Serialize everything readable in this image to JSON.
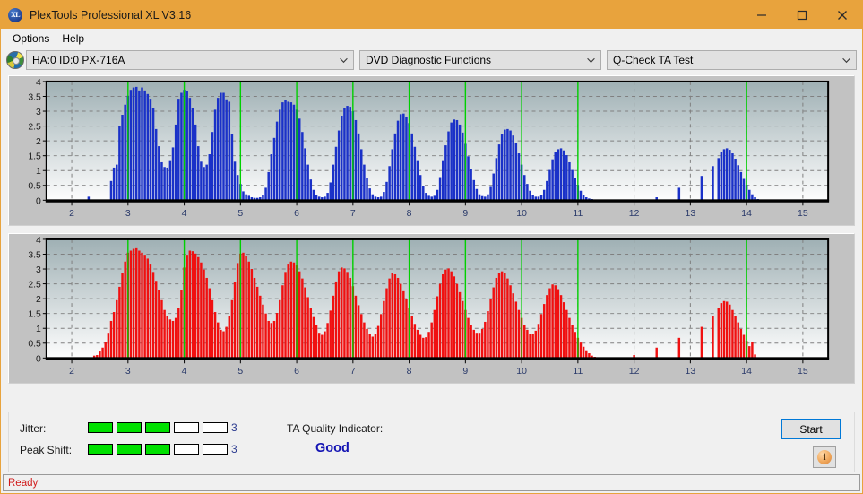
{
  "window": {
    "title": "PlexTools Professional XL V3.16",
    "app_icon": "xl-logo-icon",
    "titlebar_color": "#e8a33d",
    "minimize_label": "Minimize",
    "maximize_label": "Maximize",
    "close_label": "Close"
  },
  "menu": {
    "items": [
      {
        "label": "Options"
      },
      {
        "label": "Help"
      }
    ]
  },
  "selectors": {
    "drive": {
      "icon": "disc-icon",
      "value": "HA:0 ID:0  PX-716A"
    },
    "function": {
      "value": "DVD Diagnostic Functions"
    },
    "test": {
      "value": "Q-Check TA Test"
    }
  },
  "results": {
    "jitter_label": "Jitter:",
    "jitter_value": "3",
    "jitter_segments_total": 5,
    "jitter_segments_on": 3,
    "peak_shift_label": "Peak Shift:",
    "peak_shift_value": "3",
    "peak_segments_total": 5,
    "peak_segments_on": 3,
    "meter_on_color": "#00e000",
    "ta_quality_label": "TA Quality Indicator:",
    "ta_quality_value": "Good",
    "ta_quality_color": "#1414b4",
    "start_label": "Start",
    "info_label": "i"
  },
  "statusbar": {
    "text": "Ready",
    "color": "#d11a1a"
  },
  "chart_data": [
    {
      "id": "jitter-chart",
      "type": "bar",
      "title": "",
      "xlabel": "",
      "ylabel": "",
      "bar_color": "#1a31c8",
      "plot_bg_top": "#9fb0b4",
      "plot_bg_bottom": "#fdfdfd",
      "grid": true,
      "gridline_color": "#808080",
      "marker_color": "#00d000",
      "marker_positions": [
        3,
        4,
        5,
        6,
        7,
        8,
        9,
        10,
        11,
        14
      ],
      "xlim": [
        1.55,
        15.45
      ],
      "ylim": [
        0,
        4
      ],
      "yticks": [
        0,
        0.5,
        1,
        1.5,
        2,
        2.5,
        3,
        3.5,
        4
      ],
      "ytick_labels": [
        "0",
        "0.5",
        "1",
        "1.5",
        "2",
        "2.5",
        "3",
        "3.5",
        "4"
      ],
      "xticks": [
        2,
        3,
        4,
        5,
        6,
        7,
        8,
        9,
        10,
        11,
        12,
        13,
        14,
        15
      ],
      "xtick_labels": [
        "2",
        "3",
        "4",
        "5",
        "6",
        "7",
        "8",
        "9",
        "10",
        "11",
        "12",
        "13",
        "14",
        "15"
      ],
      "x": [
        1.6,
        1.7,
        1.8,
        1.9,
        2.0,
        2.1,
        2.2,
        2.3,
        2.4,
        2.5,
        2.6,
        2.7,
        2.75,
        2.8,
        2.85,
        2.9,
        2.95,
        3.0,
        3.05,
        3.1,
        3.15,
        3.2,
        3.25,
        3.3,
        3.35,
        3.4,
        3.45,
        3.5,
        3.55,
        3.6,
        3.65,
        3.7,
        3.75,
        3.8,
        3.85,
        3.9,
        3.95,
        4.0,
        4.05,
        4.1,
        4.15,
        4.2,
        4.25,
        4.3,
        4.35,
        4.4,
        4.45,
        4.5,
        4.55,
        4.6,
        4.65,
        4.7,
        4.75,
        4.8,
        4.85,
        4.9,
        4.95,
        5.0,
        5.05,
        5.1,
        5.15,
        5.2,
        5.25,
        5.3,
        5.35,
        5.4,
        5.45,
        5.5,
        5.55,
        5.6,
        5.65,
        5.7,
        5.75,
        5.8,
        5.85,
        5.9,
        5.95,
        6.0,
        6.05,
        6.1,
        6.15,
        6.2,
        6.25,
        6.3,
        6.35,
        6.4,
        6.45,
        6.5,
        6.55,
        6.6,
        6.65,
        6.7,
        6.75,
        6.8,
        6.85,
        6.9,
        6.95,
        7.0,
        7.05,
        7.1,
        7.15,
        7.2,
        7.25,
        7.3,
        7.35,
        7.4,
        7.45,
        7.5,
        7.55,
        7.6,
        7.65,
        7.7,
        7.75,
        7.8,
        7.85,
        7.9,
        7.95,
        8.0,
        8.05,
        8.1,
        8.15,
        8.2,
        8.25,
        8.3,
        8.35,
        8.4,
        8.45,
        8.5,
        8.55,
        8.6,
        8.65,
        8.7,
        8.75,
        8.8,
        8.85,
        8.9,
        8.95,
        9.0,
        9.05,
        9.1,
        9.15,
        9.2,
        9.25,
        9.3,
        9.35,
        9.4,
        9.45,
        9.5,
        9.55,
        9.6,
        9.65,
        9.7,
        9.75,
        9.8,
        9.85,
        9.9,
        9.95,
        10.0,
        10.05,
        10.1,
        10.15,
        10.2,
        10.25,
        10.3,
        10.35,
        10.4,
        10.45,
        10.5,
        10.55,
        10.6,
        10.65,
        10.7,
        10.75,
        10.8,
        10.85,
        10.9,
        10.95,
        11.0,
        11.05,
        11.1,
        11.15,
        11.2,
        11.25,
        11.3,
        11.4,
        11.5,
        11.6,
        11.8,
        12.0,
        12.4,
        12.8,
        13.2,
        13.4,
        13.5,
        13.55,
        13.6,
        13.65,
        13.7,
        13.75,
        13.8,
        13.85,
        13.9,
        13.95,
        14.0,
        14.05,
        14.1,
        14.15,
        14.2,
        14.25,
        14.3,
        14.4,
        14.6,
        14.8,
        15.0,
        15.2,
        15.4
      ],
      "values": [
        0,
        0,
        0,
        0,
        0,
        0,
        0,
        0.12,
        0,
        0,
        0,
        0.65,
        1.1,
        1.2,
        2.5,
        2.88,
        3.22,
        3.52,
        3.72,
        3.8,
        3.82,
        3.7,
        3.8,
        3.7,
        3.58,
        3.42,
        3.1,
        2.4,
        1.82,
        1.28,
        1.12,
        1.1,
        1.32,
        1.78,
        2.55,
        3.42,
        3.62,
        3.72,
        3.68,
        3.45,
        3.1,
        2.55,
        1.82,
        1.3,
        1.12,
        1.2,
        1.55,
        2.3,
        3.05,
        3.45,
        3.62,
        3.62,
        3.4,
        3.32,
        2.22,
        1.3,
        0.85,
        0.55,
        0.3,
        0.2,
        0.15,
        0.1,
        0.08,
        0.08,
        0.1,
        0.18,
        0.42,
        0.95,
        1.55,
        2.1,
        2.65,
        3.05,
        3.3,
        3.38,
        3.32,
        3.3,
        3.22,
        3.05,
        2.75,
        2.3,
        1.75,
        1.2,
        0.7,
        0.35,
        0.18,
        0.12,
        0.1,
        0.12,
        0.25,
        0.6,
        1.2,
        1.8,
        2.35,
        2.85,
        3.12,
        3.18,
        3.15,
        3.0,
        2.7,
        2.25,
        1.72,
        1.2,
        0.75,
        0.4,
        0.2,
        0.12,
        0.1,
        0.12,
        0.28,
        0.62,
        1.15,
        1.72,
        2.25,
        2.68,
        2.9,
        2.92,
        2.82,
        2.6,
        2.25,
        1.8,
        1.32,
        0.85,
        0.48,
        0.25,
        0.15,
        0.12,
        0.15,
        0.35,
        0.78,
        1.32,
        1.85,
        2.32,
        2.62,
        2.72,
        2.7,
        2.55,
        2.28,
        1.9,
        1.48,
        1.05,
        0.68,
        0.38,
        0.2,
        0.14,
        0.12,
        0.2,
        0.45,
        0.9,
        1.42,
        1.88,
        2.22,
        2.38,
        2.4,
        2.35,
        2.18,
        1.92,
        1.58,
        1.2,
        0.85,
        0.55,
        0.32,
        0.18,
        0.12,
        0.12,
        0.18,
        0.35,
        0.65,
        1.02,
        1.38,
        1.62,
        1.72,
        1.75,
        1.68,
        1.52,
        1.28,
        1.02,
        0.75,
        0.52,
        0.32,
        0.18,
        0.1,
        0.06,
        0.04,
        0.02,
        0,
        0,
        0,
        0,
        0,
        0.1,
        0.42,
        0.82,
        1.15,
        1.42,
        1.62,
        1.72,
        1.75,
        1.7,
        1.58,
        1.4,
        1.18,
        0.95,
        0.72,
        0.52,
        0.35,
        0.2,
        0.1,
        0.04,
        0,
        0,
        0,
        0,
        0
      ]
    },
    {
      "id": "peak-shift-chart",
      "type": "bar",
      "title": "",
      "xlabel": "",
      "ylabel": "",
      "bar_color": "#f01010",
      "plot_bg_top": "#9fb0b4",
      "plot_bg_bottom": "#fdfdfd",
      "grid": true,
      "gridline_color": "#808080",
      "marker_color": "#00d000",
      "marker_positions": [
        3,
        4,
        5,
        6,
        7,
        8,
        9,
        10,
        11,
        14
      ],
      "xlim": [
        1.55,
        15.45
      ],
      "ylim": [
        0,
        4
      ],
      "yticks": [
        0,
        0.5,
        1,
        1.5,
        2,
        2.5,
        3,
        3.5,
        4
      ],
      "ytick_labels": [
        "0",
        "0.5",
        "1",
        "1.5",
        "2",
        "2.5",
        "3",
        "3.5",
        "4"
      ],
      "xticks": [
        2,
        3,
        4,
        5,
        6,
        7,
        8,
        9,
        10,
        11,
        12,
        13,
        14,
        15
      ],
      "xtick_labels": [
        "2",
        "3",
        "4",
        "5",
        "6",
        "7",
        "8",
        "9",
        "10",
        "11",
        "12",
        "13",
        "14",
        "15"
      ],
      "x": [
        1.6,
        1.7,
        1.8,
        1.9,
        2.0,
        2.1,
        2.2,
        2.3,
        2.4,
        2.45,
        2.5,
        2.55,
        2.6,
        2.65,
        2.7,
        2.75,
        2.8,
        2.85,
        2.9,
        2.95,
        3.0,
        3.05,
        3.1,
        3.15,
        3.2,
        3.25,
        3.3,
        3.35,
        3.4,
        3.45,
        3.5,
        3.55,
        3.6,
        3.65,
        3.7,
        3.75,
        3.8,
        3.85,
        3.9,
        3.95,
        4.0,
        4.05,
        4.1,
        4.15,
        4.2,
        4.25,
        4.3,
        4.35,
        4.4,
        4.45,
        4.5,
        4.55,
        4.6,
        4.65,
        4.7,
        4.75,
        4.8,
        4.85,
        4.9,
        4.95,
        5.0,
        5.05,
        5.1,
        5.15,
        5.2,
        5.25,
        5.3,
        5.35,
        5.4,
        5.45,
        5.5,
        5.55,
        5.6,
        5.65,
        5.7,
        5.75,
        5.8,
        5.85,
        5.9,
        5.95,
        6.0,
        6.05,
        6.1,
        6.15,
        6.2,
        6.25,
        6.3,
        6.35,
        6.4,
        6.45,
        6.5,
        6.55,
        6.6,
        6.65,
        6.7,
        6.75,
        6.8,
        6.85,
        6.9,
        6.95,
        7.0,
        7.05,
        7.1,
        7.15,
        7.2,
        7.25,
        7.3,
        7.35,
        7.4,
        7.45,
        7.5,
        7.55,
        7.6,
        7.65,
        7.7,
        7.75,
        7.8,
        7.85,
        7.9,
        7.95,
        8.0,
        8.05,
        8.1,
        8.15,
        8.2,
        8.25,
        8.3,
        8.35,
        8.4,
        8.45,
        8.5,
        8.55,
        8.6,
        8.65,
        8.7,
        8.75,
        8.8,
        8.85,
        8.9,
        8.95,
        9.0,
        9.05,
        9.1,
        9.15,
        9.2,
        9.25,
        9.3,
        9.35,
        9.4,
        9.45,
        9.5,
        9.55,
        9.6,
        9.65,
        9.7,
        9.75,
        9.8,
        9.85,
        9.9,
        9.95,
        10.0,
        10.05,
        10.1,
        10.15,
        10.2,
        10.25,
        10.3,
        10.35,
        10.4,
        10.45,
        10.5,
        10.55,
        10.6,
        10.65,
        10.7,
        10.75,
        10.8,
        10.85,
        10.9,
        10.95,
        11.0,
        11.05,
        11.1,
        11.15,
        11.2,
        11.25,
        11.3,
        11.35,
        11.4,
        11.5,
        11.6,
        11.8,
        12.0,
        12.4,
        12.8,
        13.2,
        13.4,
        13.5,
        13.55,
        13.6,
        13.65,
        13.7,
        13.75,
        13.8,
        13.85,
        13.9,
        13.95,
        14.0,
        14.05,
        14.1,
        14.15,
        14.2,
        14.25,
        14.3,
        14.35,
        14.4,
        14.6,
        14.8,
        15.0,
        15.2,
        15.4
      ],
      "values": [
        0,
        0,
        0,
        0,
        0,
        0,
        0,
        0,
        0.08,
        0.1,
        0.22,
        0.35,
        0.55,
        0.85,
        1.25,
        1.55,
        1.95,
        2.4,
        2.85,
        3.25,
        3.55,
        3.62,
        3.68,
        3.7,
        3.62,
        3.55,
        3.48,
        3.35,
        3.15,
        2.9,
        2.6,
        2.28,
        1.95,
        1.62,
        1.42,
        1.3,
        1.25,
        1.35,
        1.68,
        2.3,
        3.05,
        3.48,
        3.62,
        3.6,
        3.52,
        3.4,
        3.22,
        2.98,
        2.7,
        2.35,
        1.95,
        1.55,
        1.2,
        0.95,
        0.9,
        1.05,
        1.4,
        1.95,
        2.55,
        3.2,
        3.52,
        3.55,
        3.45,
        3.25,
        3.0,
        2.7,
        2.4,
        2.1,
        1.8,
        1.5,
        1.25,
        1.18,
        1.25,
        1.52,
        1.95,
        2.45,
        2.9,
        3.15,
        3.25,
        3.22,
        3.12,
        2.92,
        2.68,
        2.38,
        2.05,
        1.7,
        1.38,
        1.1,
        0.85,
        0.78,
        0.9,
        1.18,
        1.6,
        2.1,
        2.58,
        2.92,
        3.05,
        3.02,
        2.9,
        2.7,
        2.42,
        2.1,
        1.78,
        1.48,
        1.2,
        0.98,
        0.8,
        0.72,
        0.82,
        1.08,
        1.48,
        1.92,
        2.35,
        2.68,
        2.85,
        2.82,
        2.7,
        2.5,
        2.25,
        1.98,
        1.7,
        1.42,
        1.15,
        0.95,
        0.78,
        0.68,
        0.7,
        0.88,
        1.2,
        1.62,
        2.08,
        2.5,
        2.82,
        2.98,
        3.02,
        2.92,
        2.75,
        2.5,
        2.22,
        1.92,
        1.62,
        1.35,
        1.12,
        0.95,
        0.85,
        0.85,
        0.98,
        1.22,
        1.58,
        1.98,
        2.38,
        2.7,
        2.88,
        2.92,
        2.85,
        2.68,
        2.45,
        2.18,
        1.9,
        1.62,
        1.35,
        1.12,
        0.95,
        0.82,
        0.8,
        0.92,
        1.15,
        1.48,
        1.82,
        2.12,
        2.35,
        2.48,
        2.45,
        2.32,
        2.12,
        1.88,
        1.62,
        1.35,
        1.1,
        0.88,
        0.68,
        0.52,
        0.38,
        0.26,
        0.16,
        0.08,
        0.04,
        0,
        0,
        0,
        0,
        0,
        0.1,
        0.35,
        0.68,
        1.05,
        1.4,
        1.68,
        1.85,
        1.92,
        1.9,
        1.8,
        1.62,
        1.42,
        1.2,
        0.98,
        0.78,
        0.58,
        0.4,
        0.55,
        0.12,
        0,
        0,
        0,
        0,
        0
      ]
    }
  ]
}
